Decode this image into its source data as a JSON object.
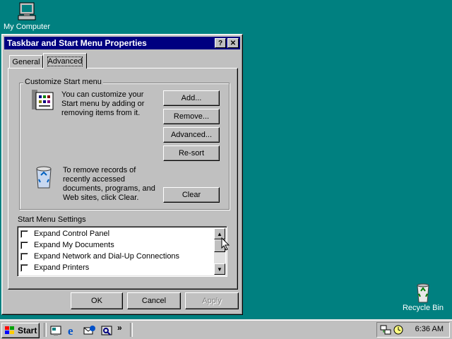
{
  "desktop": {
    "my_computer_label": "My Computer",
    "recycle_bin_label": "Recycle Bin"
  },
  "dialog": {
    "title": "Taskbar and Start Menu Properties",
    "help_glyph": "?",
    "close_glyph": "✕",
    "tabs": [
      {
        "label": "General",
        "active": false
      },
      {
        "label": "Advanced",
        "active": true
      }
    ],
    "customize_group": {
      "label": "Customize Start menu",
      "description": "You can customize your Start menu by adding or removing items from it.",
      "buttons": {
        "add": "Add...",
        "remove": "Remove...",
        "advanced": "Advanced...",
        "resort": "Re-sort",
        "clear": "Clear"
      },
      "clear_description": "To remove records of recently accessed documents, programs, and Web sites,  click Clear."
    },
    "settings": {
      "label": "Start Menu Settings",
      "items": [
        {
          "label": "Expand Control Panel",
          "checked": false
        },
        {
          "label": "Expand My Documents",
          "checked": false
        },
        {
          "label": "Expand Network and Dial-Up Connections",
          "checked": false
        },
        {
          "label": "Expand Printers",
          "checked": false
        }
      ]
    },
    "footer": {
      "ok": "OK",
      "cancel": "Cancel",
      "apply": "Apply"
    }
  },
  "taskbar": {
    "start_label": "Start",
    "chevron": "»",
    "clock": "6:36 AM",
    "quick_launch_icons": [
      "show-desktop-icon",
      "internet-explorer-icon",
      "outlook-express-icon",
      "channels-icon"
    ]
  },
  "colors": {
    "desktop": "#008080",
    "titlebar": "#000080",
    "face": "#c0c0c0"
  }
}
